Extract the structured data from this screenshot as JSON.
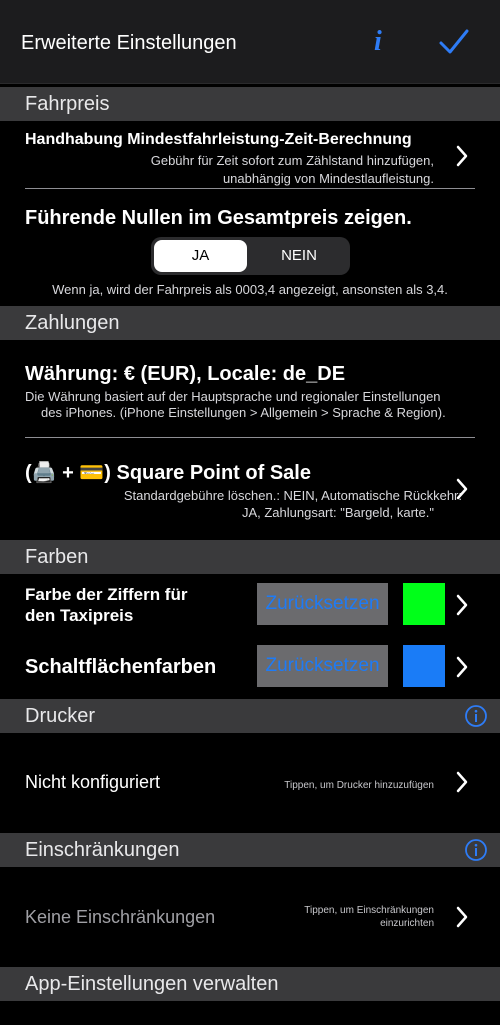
{
  "navbar": {
    "title": "Erweiterte Einstellungen",
    "info_icon": "info-italic-icon",
    "info_label": "i",
    "done_icon": "checkmark-icon"
  },
  "sections": {
    "fahrpreis": "Fahrpreis",
    "zahlungen": "Zahlungen",
    "farben": "Farben",
    "drucker": "Drucker",
    "einschraenkungen": "Einschränkungen",
    "app": "App-Einstellungen verwalten"
  },
  "fahrpreis": {
    "min_title": "Handhabung Mindestfahrleistung-Zeit-Berechnung",
    "min_sub1": "Gebühr für Zeit sofort zum Zählstand hinzufügen,",
    "min_sub2": "unabhängig von Mindestlaufleistung.",
    "zeros_title": "Führende Nullen im Gesamtpreis zeigen.",
    "seg_yes": "JA",
    "seg_no": "NEIN",
    "seg_selected": "JA",
    "zeros_note": "Wenn ja, wird der Fahrpreis als 0003,4 angezeigt, ansonsten als 3,4."
  },
  "zahlungen": {
    "currency_title": "Währung: € (EUR), Locale: de_DE",
    "currency_sub1": "Die Währung basiert auf der Hauptsprache und regionaler Einstellungen",
    "currency_sub2": "des iPhones. (iPhone Einstellungen > Allgemein > Sprache & Region).",
    "square_title": "(🖨️ + 💳) Square Point of Sale",
    "square_sub1": "Standardgebühre löschen.: NEIN, Automatische Rückkehr:",
    "square_sub2": "JA, Zahlungsart: \"Bargeld, karte.\""
  },
  "farben": {
    "digits_label_1": "Farbe der Ziffern für",
    "digits_label_2": "den Taxipreis",
    "digits_reset": "Zurücksetzen",
    "digits_color": "#00ff19",
    "buttons_label": "Schaltflächenfarben",
    "buttons_reset": "Zurücksetzen",
    "buttons_color": "#1a7cf7"
  },
  "drucker": {
    "status": "Nicht konfiguriert",
    "hint": "Tippen, um Drucker hinzuzufügen"
  },
  "einschraenkungen": {
    "status": "Keine Einschränkungen",
    "hint1": "Tippen, um Einschränkungen",
    "hint2": "einzurichten"
  },
  "colors": {
    "accent": "#2e7cf6",
    "header_bg": "#3a3a3c",
    "navbar_bg": "#1c1c1e"
  }
}
